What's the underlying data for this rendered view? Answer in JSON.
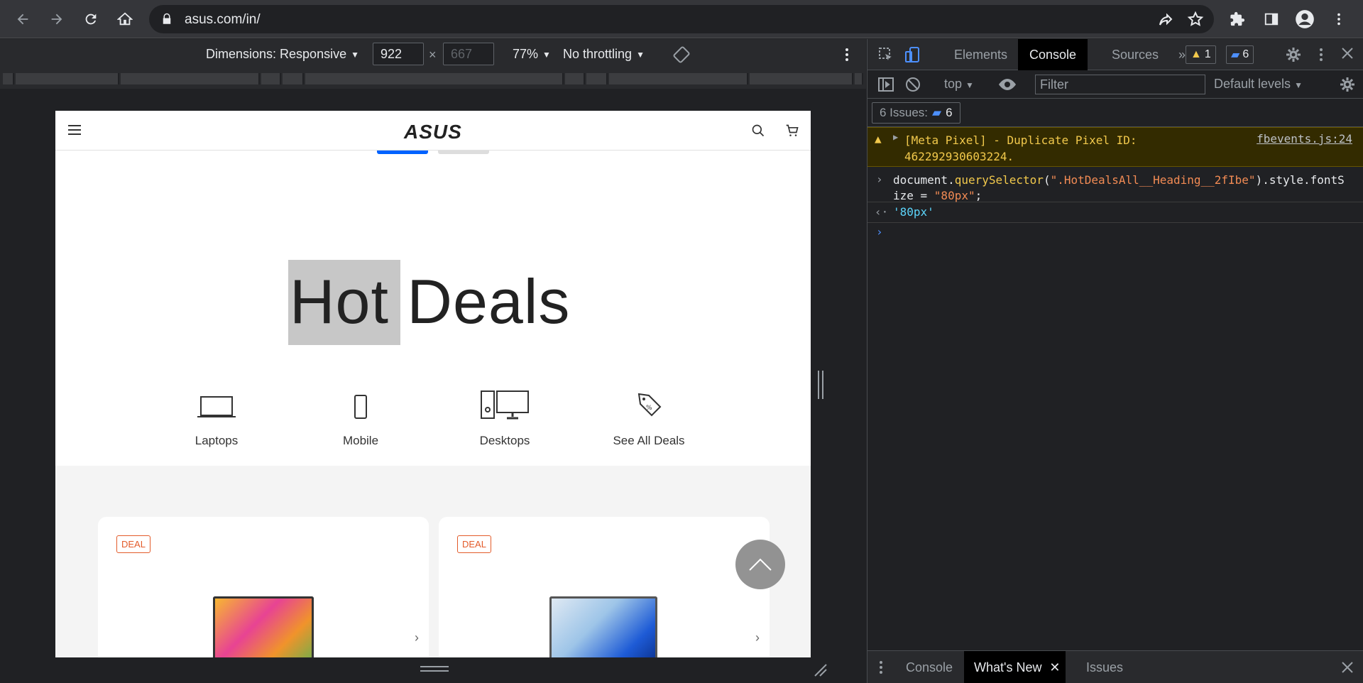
{
  "browser": {
    "url": "asus.com/in/"
  },
  "device_toolbar": {
    "dimensions_label": "Dimensions: Responsive",
    "width": "922",
    "height": "667",
    "times": "×",
    "zoom": "77%",
    "throttling": "No throttling"
  },
  "site": {
    "logo": "ASUS",
    "hero_title": "Hot Deals",
    "categories": [
      {
        "label": "Laptops",
        "icon": "laptop-icon"
      },
      {
        "label": "Mobile",
        "icon": "mobile-icon"
      },
      {
        "label": "Desktops",
        "icon": "desktop-icon"
      },
      {
        "label": "See All Deals",
        "icon": "price-tag-icon"
      }
    ],
    "deal_tag": "DEAL",
    "accent_color": "#0062ff",
    "deal_color": "#e35b2a"
  },
  "devtools": {
    "tabs": [
      "Elements",
      "Console",
      "Sources"
    ],
    "active_tab": "Console",
    "warning_count": "1",
    "message_count": "6",
    "context": "top",
    "filter_placeholder": "Filter",
    "levels": "Default levels",
    "issues_label": "6 Issues:",
    "issues_count": "6",
    "warning": {
      "message": "[Meta Pixel] - Duplicate Pixel ID: 462292930603224.",
      "source": "fbevents.js:24"
    },
    "command": {
      "prefix": "document.",
      "method": "querySelector",
      "open": "(",
      "arg": "\".HotDealsAll__Heading__2fIbe\"",
      "rest": ").style.fontSize = ",
      "value": "\"80px\"",
      "end": ";"
    },
    "output": "'80px'",
    "drawer_tabs": [
      "Console",
      "What's New",
      "Issues"
    ],
    "drawer_active": "What's New"
  }
}
